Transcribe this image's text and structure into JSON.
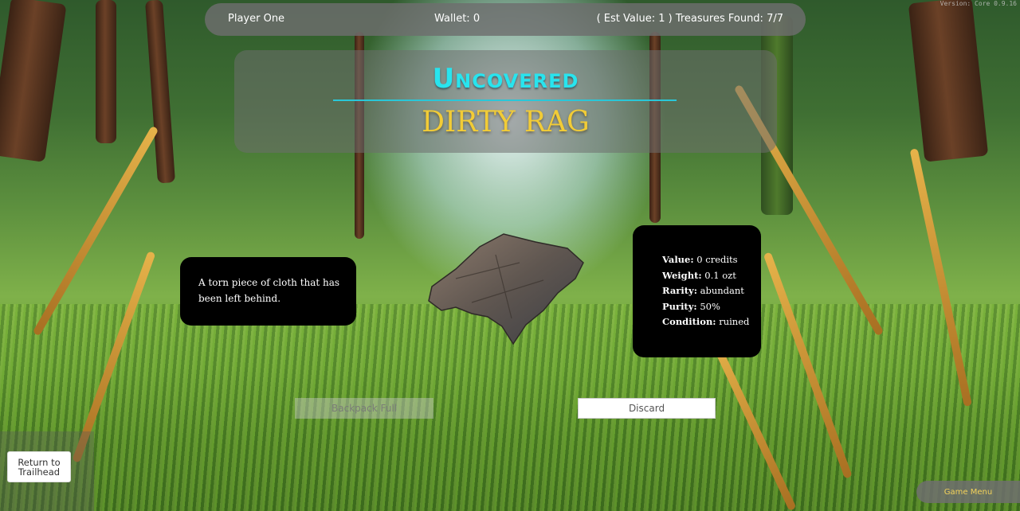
{
  "version": "Version: Core 0.9.16",
  "hud": {
    "player": "Player One",
    "wallet": "Wallet: 0",
    "summary": "( Est Value: 1 ) Treasures Found: 7/7"
  },
  "banner": {
    "title": "Uncovered",
    "item_name": "DIRTY RAG"
  },
  "item": {
    "description": "A torn piece of cloth that has been left behind.",
    "stats": [
      {
        "label": "Value:",
        "value": "0 credits"
      },
      {
        "label": "Weight:",
        "value": "0.1 ozt"
      },
      {
        "label": "Rarity:",
        "value": "abundant"
      },
      {
        "label": "Purity:",
        "value": "50%"
      },
      {
        "label": "Condition:",
        "value": "ruined"
      }
    ],
    "image_icon": "dirty-rag"
  },
  "actions": {
    "backpack": "Backpack Full",
    "discard": "Discard",
    "return_trailhead": "Return to Trailhead",
    "game_menu": "Game Menu"
  },
  "colors": {
    "title": "#28e4ee",
    "item_name": "#f2cc36",
    "menu_text": "#f3d25a"
  }
}
